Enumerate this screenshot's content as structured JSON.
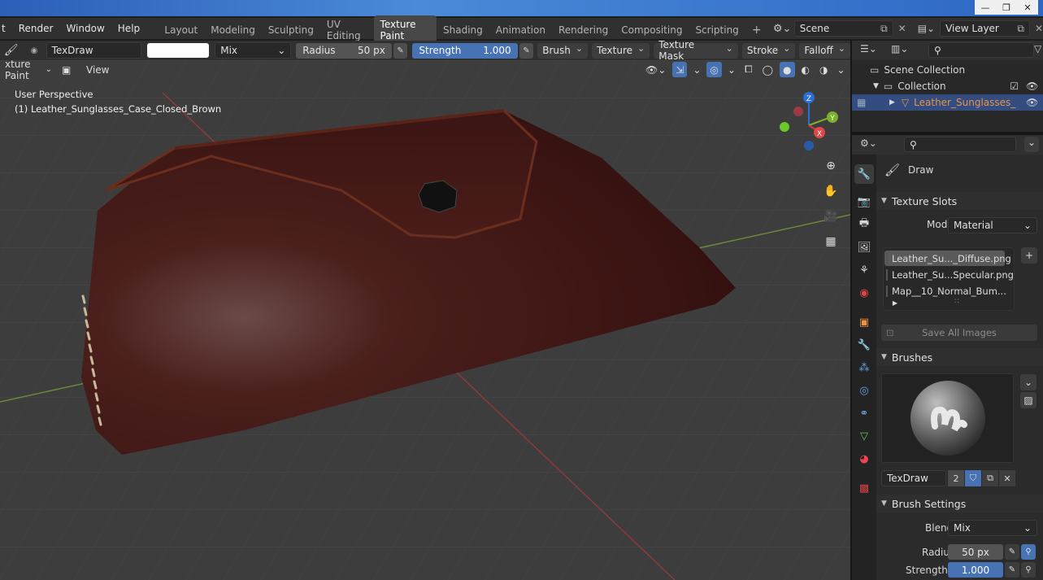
{
  "topbar": {
    "menus": [
      "t",
      "Render",
      "Window",
      "Help"
    ],
    "workspaces": [
      "Layout",
      "Modeling",
      "Sculpting",
      "UV Editing",
      "Texture Paint",
      "Shading",
      "Animation",
      "Rendering",
      "Compositing",
      "Scripting"
    ],
    "active_workspace": "Texture Paint",
    "add_tab": "+",
    "scene": "Scene",
    "view_layer": "View Layer"
  },
  "tool_header": {
    "brush_name": "TexDraw",
    "blend": "Mix",
    "radius_label": "Radius",
    "radius_value": "50 px",
    "strength_label": "Strength",
    "strength_value": "1.000",
    "menus": [
      "Brush",
      "Texture",
      "Texture Mask",
      "Stroke",
      "Falloff"
    ]
  },
  "viewport": {
    "mode": "xture Paint",
    "view_menu": "View",
    "perspective": "User Perspective",
    "object_label": "(1) Leather_Sunglasses_Case_Closed_Brown",
    "gizmo": {
      "z": "Z",
      "y": "Y",
      "x": "X"
    }
  },
  "outliner": {
    "scene_collection": "Scene Collection",
    "collection": "Collection",
    "object": "Leather_Sunglasses_"
  },
  "properties": {
    "tool_name": "Draw",
    "texture_slots_title": "Texture Slots",
    "mode_label": "Mode",
    "mode_value": "Material",
    "slots": [
      {
        "name": "Leather_Su..._Diffuse.png",
        "color": "#5a2418",
        "selected": true
      },
      {
        "name": "Leather_Su...Specular.png",
        "color": "#4a2a1e",
        "selected": false
      },
      {
        "name": "Map__10_Normal_Bum...",
        "color": "#8080ff",
        "selected": false
      }
    ],
    "save_all": "Save All Images",
    "brushes_title": "Brushes",
    "brush_name": "TexDraw",
    "brush_users": "2",
    "brush_settings_title": "Brush Settings",
    "blend_label": "Blend",
    "blend_value": "Mix",
    "radius_label": "Radius",
    "radius_value": "50 px",
    "strength_label": "Strength",
    "strength_value": "1.000"
  },
  "colors": {
    "accent": "#4772b3",
    "selection": "#334d80",
    "object_orange": "#e89346"
  }
}
